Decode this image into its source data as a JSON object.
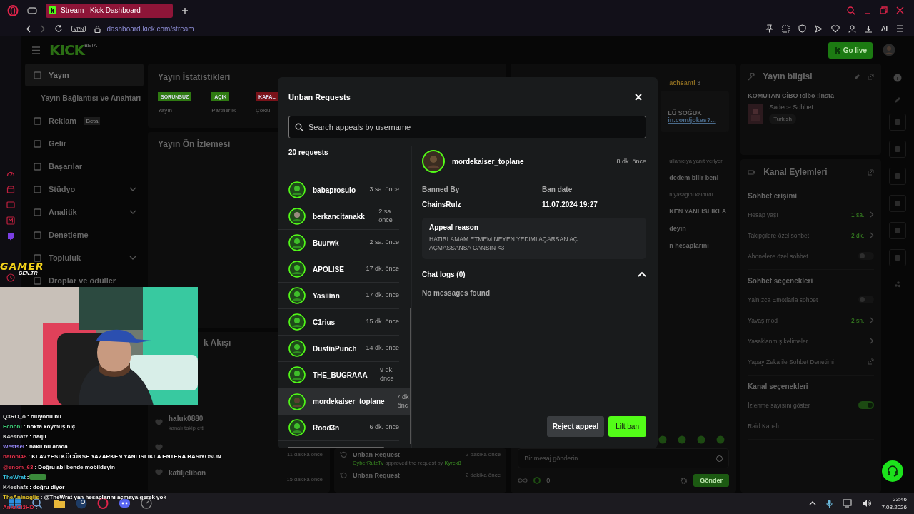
{
  "browser": {
    "tab_title": "Stream - Kick Dashboard",
    "url": "dashboard.kick.com/stream",
    "vpn": "VPN",
    "ai": "AI"
  },
  "header": {
    "logo": "KICK",
    "logo_tag": "BETA",
    "go_live": "Go live"
  },
  "sidebar": {
    "items": [
      {
        "label": "Yayın",
        "kind": "item",
        "selected": true
      },
      {
        "label": "Yayın Bağlantısı ve Anahtarı",
        "kind": "sub",
        "selected": false
      },
      {
        "label": "Reklam",
        "kind": "item",
        "selected": false,
        "badge": "Beta"
      },
      {
        "label": "Gelir",
        "kind": "item",
        "selected": false
      },
      {
        "label": "Başarılar",
        "kind": "item",
        "selected": false
      },
      {
        "label": "Stüdyo",
        "kind": "group",
        "selected": false
      },
      {
        "label": "Analitik",
        "kind": "group",
        "selected": false
      },
      {
        "label": "Denetleme",
        "kind": "item",
        "selected": false
      },
      {
        "label": "Topluluk",
        "kind": "group",
        "selected": false
      },
      {
        "label": "Droplar ve ödüller",
        "kind": "item",
        "selected": false
      }
    ]
  },
  "stats": {
    "title": "Yayın İstatistikleri",
    "badges": [
      {
        "label": "SORUNSUZ",
        "caption": "Yayın",
        "color": "#2f7a12"
      },
      {
        "label": "AÇIK",
        "caption": "Partnerlik",
        "color": "#2f7a12"
      },
      {
        "label": "KAPAL",
        "caption": "Çoklu",
        "color": "#7a1219"
      }
    ]
  },
  "preview": {
    "title": "Yayın Ön İzlemesi"
  },
  "activity": {
    "title": "k Akışı",
    "rows": [
      {
        "name": "haluk0880",
        "action": "kanalı takip etti"
      },
      {
        "time": "11 dakika önce"
      },
      {
        "name": "katiljelibon",
        "time": "15 dakika önce"
      }
    ]
  },
  "mod_log": {
    "rows": [
      {
        "title": "Unban Request",
        "time": "2 dakika önce",
        "actor": "CyberRulzTv",
        "detail": "approved the request by",
        "target": "Kyrex8"
      },
      {
        "title": "Unban Request",
        "time": "2 dakika önce"
      }
    ]
  },
  "chat": {
    "pinned_user": "achsanti",
    "pinned_count": "3",
    "pinned_lines": [
      "LÜ SOĞUK",
      "in.com/jokes?..."
    ],
    "messages": [
      {
        "text": "ullanıcıya yanıt veriyor",
        "kind": "reply"
      },
      {
        "text": "dedem bilir beni",
        "kind": "msg"
      },
      {
        "text": "n yasağını kaldırdı",
        "kind": "reply"
      },
      {
        "text": "KEN YANLISLIKLA",
        "kind": "msg"
      },
      {
        "text": "deyin",
        "kind": "msg"
      },
      {
        "text": "n hesaplarını",
        "kind": "msg"
      }
    ],
    "input_placeholder": "Bir mesaj gönderin",
    "points": "0",
    "send": "Gönder"
  },
  "stream_info": {
    "title": "Yayın bilgisi",
    "stream_title": "KOMUTAN CİBO !cibo !insta",
    "category": "Sadece Sohbet",
    "tag": "Turkish"
  },
  "channel_actions": {
    "title": "Kanal Eylemleri",
    "sections": [
      {
        "title": "Sohbet erişimi",
        "rows": [
          {
            "kind": "value",
            "label": "Hesap yaşı",
            "value": "1 sa."
          },
          {
            "kind": "value",
            "label": "Takipçilere özel sohbet",
            "value": "2 dk."
          },
          {
            "kind": "toggle",
            "label": "Abonelere özel sohbet",
            "on": false
          }
        ]
      },
      {
        "title": "Sohbet seçenekleri",
        "rows": [
          {
            "kind": "toggle",
            "label": "Yalnızca Emotlarla sohbet",
            "on": false
          },
          {
            "kind": "value",
            "label": "Yavaş mod",
            "value": "2 sn."
          },
          {
            "kind": "value",
            "label": "Yasaklanmış kelimeler"
          },
          {
            "kind": "external",
            "label": "Yapay Zeka ile Sohbet Denetimi"
          }
        ]
      },
      {
        "title": "Kanal seçenekleri",
        "rows": [
          {
            "kind": "toggle",
            "label": "İzlenme sayısını göster",
            "on": true
          },
          {
            "kind": "plain",
            "label": "Raid Kanalı"
          }
        ]
      }
    ]
  },
  "modal": {
    "title": "Unban Requests",
    "search_placeholder": "Search appeals by username",
    "count": "20 requests",
    "requests": [
      {
        "name": "babaprosulo",
        "time": "3 sa. önce",
        "selected": false
      },
      {
        "name": "berkancitanakk",
        "time": "2 sa. önce",
        "selected": false
      },
      {
        "name": "Buurwk",
        "time": "2 sa. önce",
        "selected": false
      },
      {
        "name": "APOLISE",
        "time": "17 dk. önce",
        "selected": false
      },
      {
        "name": "Yasiiinn",
        "time": "17 dk. önce",
        "selected": false
      },
      {
        "name": "C1rius",
        "time": "15 dk. önce",
        "selected": false
      },
      {
        "name": "DustinPunch",
        "time": "14 dk. önce",
        "selected": false
      },
      {
        "name": "THE_BUGRAAA",
        "time": "9 dk. önce",
        "selected": false
      },
      {
        "name": "mordekaiser_toplane",
        "time": "7 dk önc",
        "selected": true
      },
      {
        "name": "Rood3n",
        "time": "6 dk. önce",
        "selected": false
      }
    ],
    "detail": {
      "user": "mordekaiser_toplane",
      "time": "8 dk. önce",
      "banned_by_label": "Banned By",
      "banned_by": "ChainsRulz",
      "ban_date_label": "Ban date",
      "ban_date": "11.07.2024 19:27",
      "appeal_label": "Appeal reason",
      "appeal_text": "HATIRLAMAM ETMEM NEYEN YEDİMİ AÇARSAN AÇ AÇMASSANSA CANSIN <3",
      "chat_logs": "Chat logs (0)",
      "chat_logs_expanded": true,
      "empty": "No messages found"
    },
    "reject": "Reject appeal",
    "lift": "Lift ban"
  },
  "overlay": {
    "brand": "GAMER",
    "brand_sub": "GEN.TR",
    "chat": [
      {
        "user": "Q3RO_o",
        "color": "#dddddd",
        "text": ": oluyodu bu"
      },
      {
        "user": "Echoni",
        "color": "#3fd17a",
        "text": ": nokta koymuş hiç"
      },
      {
        "user": "K4eshafz",
        "color": "#dddddd",
        "text": ": haqlı"
      },
      {
        "user": "Westsel",
        "color": "#9b8cff",
        "text": ": haklı bu arada"
      },
      {
        "user": "baroni48",
        "color": "#e0314a",
        "text": ": KLAVYESI KÜCÜKSE YAZARKEN YANLISLIKLA ENTERA BASIYOSUN"
      },
      {
        "user": "@enom_63",
        "color": "#e0314a",
        "text": ": Doğru abi bende mobildeyin"
      },
      {
        "user": "TheWrat",
        "color": "#38c6e8",
        "text": ":",
        "emote": true
      },
      {
        "user": "K4eshafz",
        "color": "#dddddd",
        "text": ": doğru diyor"
      },
      {
        "user": "TheAninoglis",
        "color": "#e8c62a",
        "text": ": @TheWrat yan hesaplarını açmaya gerek yok"
      },
      {
        "user": "AnkaCi3HD",
        "color": "#e0314a",
        "text": ":"
      }
    ]
  },
  "taskbar": {
    "time": "23:46",
    "date": "7.08.2026"
  }
}
